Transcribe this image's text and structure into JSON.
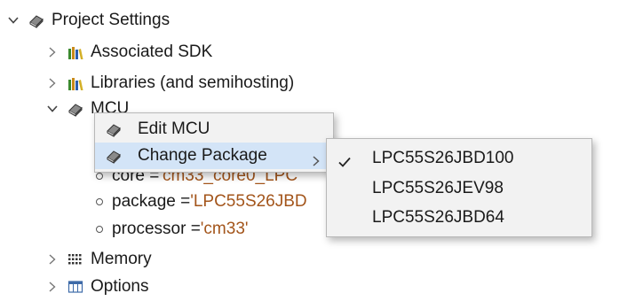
{
  "tree": {
    "root_label": "Project Settings",
    "associated_sdk": "Associated SDK",
    "libraries": "Libraries (and semihosting)",
    "mcu": "MCU",
    "core_label": "core = ",
    "core_value": "'cm33_core0_LPC",
    "package_label": "package = ",
    "package_value": "'LPC55S26JBD",
    "processor_label": "processor = ",
    "processor_value": "'cm33'",
    "memory": "Memory",
    "options": "Options"
  },
  "context_menu": {
    "edit_mcu": "Edit MCU",
    "change_package": "Change Package"
  },
  "package_submenu": {
    "items": [
      "LPC55S26JBD100",
      "LPC55S26JEV98",
      "LPC55S26JBD64"
    ],
    "selected": "LPC55S26JBD100"
  },
  "colors": {
    "menu_background": "#f2f2f2",
    "menu_highlight": "#d3e4f7",
    "string_value": "#a3551b"
  },
  "icons": {
    "project": "book-icon",
    "sdk": "library-books-icon",
    "memory": "memory-chip-icon",
    "options": "table-icon"
  }
}
